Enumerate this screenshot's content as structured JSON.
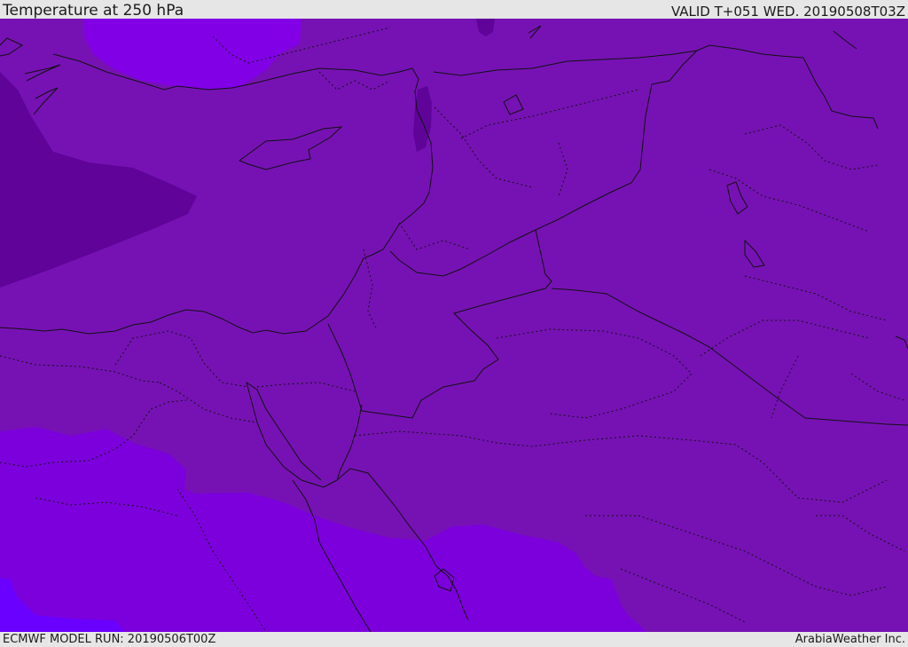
{
  "header": {
    "title": "Temperature at 250 hPa",
    "valid": "VALID T+051 WED. 20190508T03Z"
  },
  "footer": {
    "model_run": "ECMWF MODEL RUN: 20190506T00Z",
    "credit": "ArabiaWeather Inc."
  },
  "map": {
    "field": "temperature",
    "level": "250 hPa",
    "colors": {
      "base": "#7612b4",
      "warm_patch": "#5f0399",
      "cool_north": "#8100e6",
      "cool_south": "#7c00dc",
      "cold_patch": "#6a00ff",
      "coast": "#111111",
      "border": "#111111"
    }
  }
}
